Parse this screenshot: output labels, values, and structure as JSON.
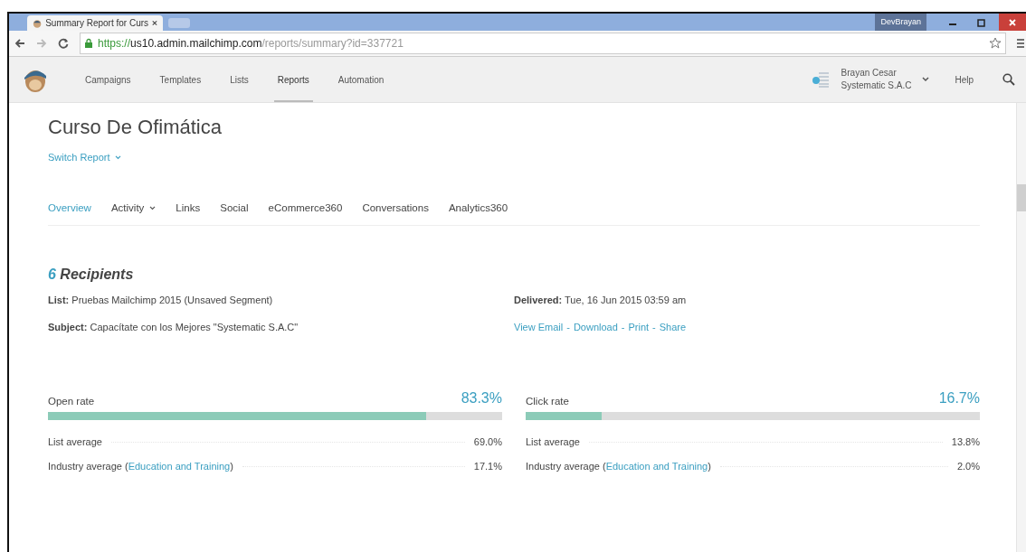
{
  "browser": {
    "tab_title": "Summary Report for Curs",
    "profile": "DevBrayan",
    "url_scheme": "https://",
    "url_host": "us10.admin.mailchimp.com",
    "url_path": "/reports/summary?id=337721"
  },
  "nav": {
    "items": [
      {
        "label": "Campaigns",
        "selected": false
      },
      {
        "label": "Templates",
        "selected": false
      },
      {
        "label": "Lists",
        "selected": false
      },
      {
        "label": "Reports",
        "selected": true
      },
      {
        "label": "Automation",
        "selected": false
      }
    ],
    "user_name": "Brayan Cesar",
    "user_org": "Systematic S.A.C",
    "help": "Help"
  },
  "report": {
    "title": "Curso De Ofimática",
    "switch": "Switch Report",
    "tabs": [
      {
        "label": "Overview",
        "selected": true,
        "dropdown": false
      },
      {
        "label": "Activity",
        "selected": false,
        "dropdown": true
      },
      {
        "label": "Links",
        "selected": false,
        "dropdown": false
      },
      {
        "label": "Social",
        "selected": false,
        "dropdown": false
      },
      {
        "label": "eCommerce360",
        "selected": false,
        "dropdown": false
      },
      {
        "label": "Conversations",
        "selected": false,
        "dropdown": false
      },
      {
        "label": "Analytics360",
        "selected": false,
        "dropdown": false
      }
    ],
    "recipients_count": "6",
    "recipients_label": "Recipients",
    "details_left": [
      {
        "label": "List:",
        "value": "Pruebas Mailchimp 2015 (Unsaved Segment)"
      },
      {
        "label": "Subject:",
        "value": "Capacítate con los Mejores \"Systematic S.A.C\""
      }
    ],
    "delivered": {
      "label": "Delivered:",
      "value": "Tue, 16 Jun 2015 03:59 am"
    },
    "links": [
      "View Email",
      "Download",
      "Print",
      "Share"
    ],
    "link_separator": "-",
    "stats": [
      {
        "label": "Open rate",
        "value": "83.3%",
        "level": 0.833,
        "list_average": {
          "label": "List average",
          "value": "69.0%"
        },
        "industry": {
          "prefix": "Industry average (",
          "link": "Education and Training",
          "suffix": ")",
          "value": "17.1%"
        }
      },
      {
        "label": "Click rate",
        "value": "16.7%",
        "level": 0.167,
        "list_average": {
          "label": "List average",
          "value": "13.8%"
        },
        "industry": {
          "prefix": "Industry average (",
          "link": "Education and Training",
          "suffix": ")",
          "value": "2.0%"
        }
      }
    ]
  }
}
